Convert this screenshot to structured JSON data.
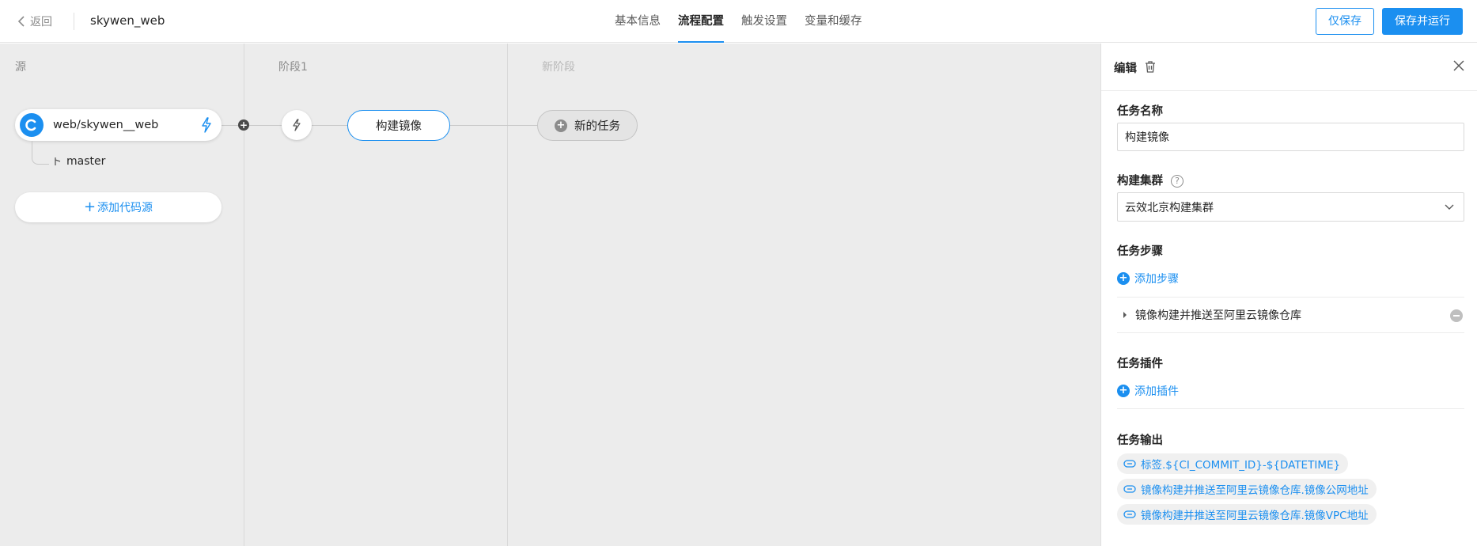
{
  "header": {
    "back_label": "返回",
    "pipeline_name": "skywen_web",
    "tabs": [
      {
        "label": "基本信息",
        "active": false
      },
      {
        "label": "流程配置",
        "active": true
      },
      {
        "label": "触发设置",
        "active": false
      },
      {
        "label": "变量和缓存",
        "active": false
      }
    ],
    "save_label": "仅保存",
    "save_run_label": "保存并运行"
  },
  "canvas": {
    "columns": [
      {
        "title": "源"
      },
      {
        "title": "阶段1"
      },
      {
        "title": "新阶段"
      }
    ],
    "source": {
      "repo": "web/skywen__web",
      "branch": "master",
      "add_label": "添加代码源"
    },
    "job_label": "构建镜像",
    "new_task_label": "新的任务"
  },
  "panel": {
    "title": "编辑",
    "task_name_label": "任务名称",
    "task_name_value": "构建镜像",
    "cluster_label": "构建集群",
    "cluster_value": "云效北京构建集群",
    "steps_label": "任务步骤",
    "add_step_label": "添加步骤",
    "steps": [
      {
        "name": "镜像构建并推送至阿里云镜像仓库"
      }
    ],
    "plugins_label": "任务插件",
    "add_plugin_label": "添加插件",
    "outputs_label": "任务输出",
    "outputs": [
      "标签.${CI_COMMIT_ID}-${DATETIME}",
      "镜像构建并推送至阿里云镜像仓库.镜像公网地址",
      "镜像构建并推送至阿里云镜像仓库.镜像VPC地址"
    ]
  },
  "colors": {
    "accent": "#1b8ff0",
    "canvas_bg": "#ececec"
  }
}
